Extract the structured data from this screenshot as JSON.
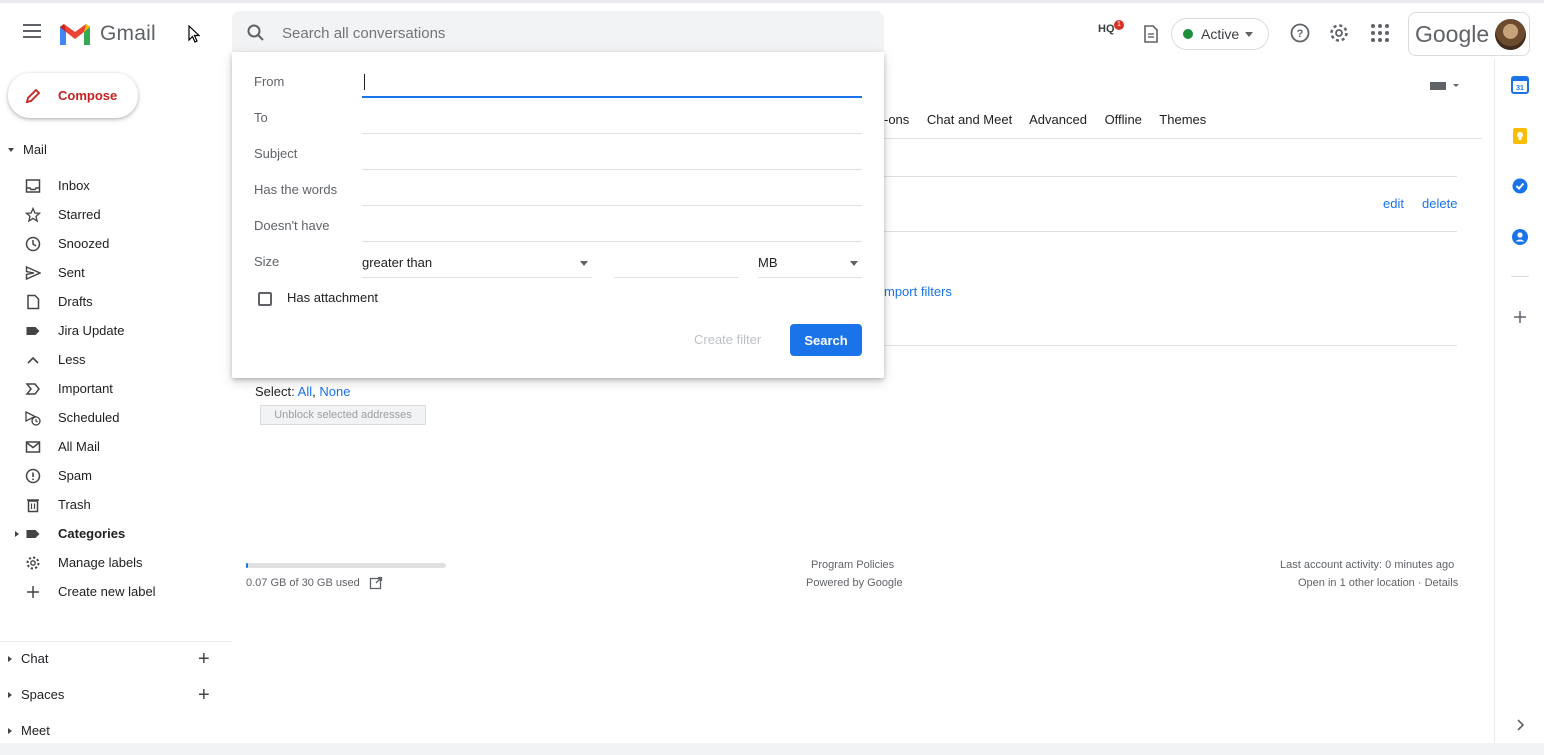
{
  "header": {
    "app_name": "Gmail",
    "search_placeholder": "Search all conversations",
    "hq_label": "HQ",
    "hq_badge": "1",
    "status": "Active",
    "account_brand": "Google"
  },
  "compose": {
    "label": "Compose"
  },
  "sidebar": {
    "mail_header": "Mail",
    "items": [
      {
        "label": "Inbox",
        "icon": "inbox-icon"
      },
      {
        "label": "Starred",
        "icon": "star-icon"
      },
      {
        "label": "Snoozed",
        "icon": "clock-icon"
      },
      {
        "label": "Sent",
        "icon": "send-icon"
      },
      {
        "label": "Drafts",
        "icon": "draft-icon"
      },
      {
        "label": "Jira Update",
        "icon": "label-icon"
      },
      {
        "label": "Less",
        "icon": "chevron-up-icon"
      },
      {
        "label": "Important",
        "icon": "important-icon"
      },
      {
        "label": "Scheduled",
        "icon": "scheduled-icon"
      },
      {
        "label": "All Mail",
        "icon": "all-mail-icon"
      },
      {
        "label": "Spam",
        "icon": "spam-icon"
      },
      {
        "label": "Trash",
        "icon": "trash-icon"
      },
      {
        "label": "Categories",
        "icon": "label-icon"
      },
      {
        "label": "Manage labels",
        "icon": "gear-icon"
      },
      {
        "label": "Create new label",
        "icon": "plus-icon"
      }
    ],
    "sections": [
      {
        "label": "Chat"
      },
      {
        "label": "Spaces"
      },
      {
        "label": "Meet"
      }
    ]
  },
  "settings": {
    "tabs": [
      "-ons",
      "Chat and Meet",
      "Advanced",
      "Offline",
      "Themes"
    ],
    "edit": "edit",
    "delete": "delete",
    "import_filters": "mport filters",
    "select_label": "Select:",
    "select_all": "All",
    "select_none": "None",
    "unblock_button": "Unblock selected addresses"
  },
  "footer": {
    "storage": "0.07 GB of 30 GB used",
    "storage_fraction": 0.0023,
    "program_policies": "Program Policies",
    "powered_by": "Powered by Google",
    "last_activity": "Last account activity: 0 minutes ago",
    "open_in": "Open in 1 other location · Details"
  },
  "search_panel": {
    "from_label": "From",
    "to_label": "To",
    "subject_label": "Subject",
    "has_words_label": "Has the words",
    "doesnt_have_label": "Doesn't have",
    "size_label": "Size",
    "size_operator": "greater than",
    "size_unit": "MB",
    "has_attachment": "Has attachment",
    "create_filter": "Create filter",
    "search_button": "Search"
  },
  "colors": {
    "accent": "#1a73e8",
    "compose_red": "#c5221f",
    "active_green": "#1e8e3e"
  }
}
